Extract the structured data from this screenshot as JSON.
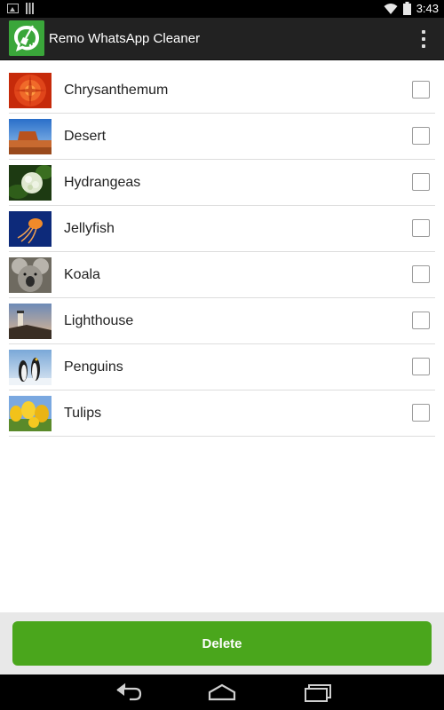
{
  "status_bar": {
    "time": "3:43",
    "icons": [
      "image-notification-icon",
      "barcode-notification-icon",
      "wifi-icon",
      "battery-icon"
    ]
  },
  "action_bar": {
    "title": "Remo WhatsApp Cleaner",
    "app_icon": "broom-cleaner-icon",
    "menu_icon": "overflow-menu-icon"
  },
  "files": [
    {
      "name": "Chrysanthemum",
      "checked": false
    },
    {
      "name": "Desert",
      "checked": false
    },
    {
      "name": "Hydrangeas",
      "checked": false
    },
    {
      "name": "Jellyfish",
      "checked": false
    },
    {
      "name": "Koala",
      "checked": false
    },
    {
      "name": "Lighthouse",
      "checked": false
    },
    {
      "name": "Penguins",
      "checked": false
    },
    {
      "name": "Tulips",
      "checked": false
    }
  ],
  "bottom": {
    "delete_label": "Delete"
  },
  "colors": {
    "accent": "#4aa61c",
    "action_bar": "#222222",
    "app_icon": "#3aa63a"
  },
  "nav": {
    "icons": [
      "back-icon",
      "home-icon",
      "recent-apps-icon"
    ]
  }
}
